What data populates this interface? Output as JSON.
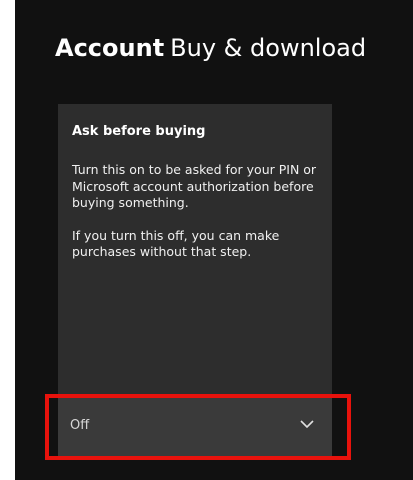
{
  "header": {
    "section": "Account",
    "page": "Buy & download"
  },
  "panel": {
    "title": "Ask before buying",
    "paragraphs": [
      "Turn this on to be asked for your PIN or Microsoft account authorization before buying something.",
      "If you turn this off, you can make purchases without that step."
    ]
  },
  "dropdown": {
    "value": "Off",
    "icon": "chevron-down-icon"
  },
  "colors": {
    "background": "#111111",
    "panel": "#2d2d2d",
    "dropdown": "#3a3a3a",
    "highlight": "#e8120c",
    "text": "#ffffff"
  }
}
